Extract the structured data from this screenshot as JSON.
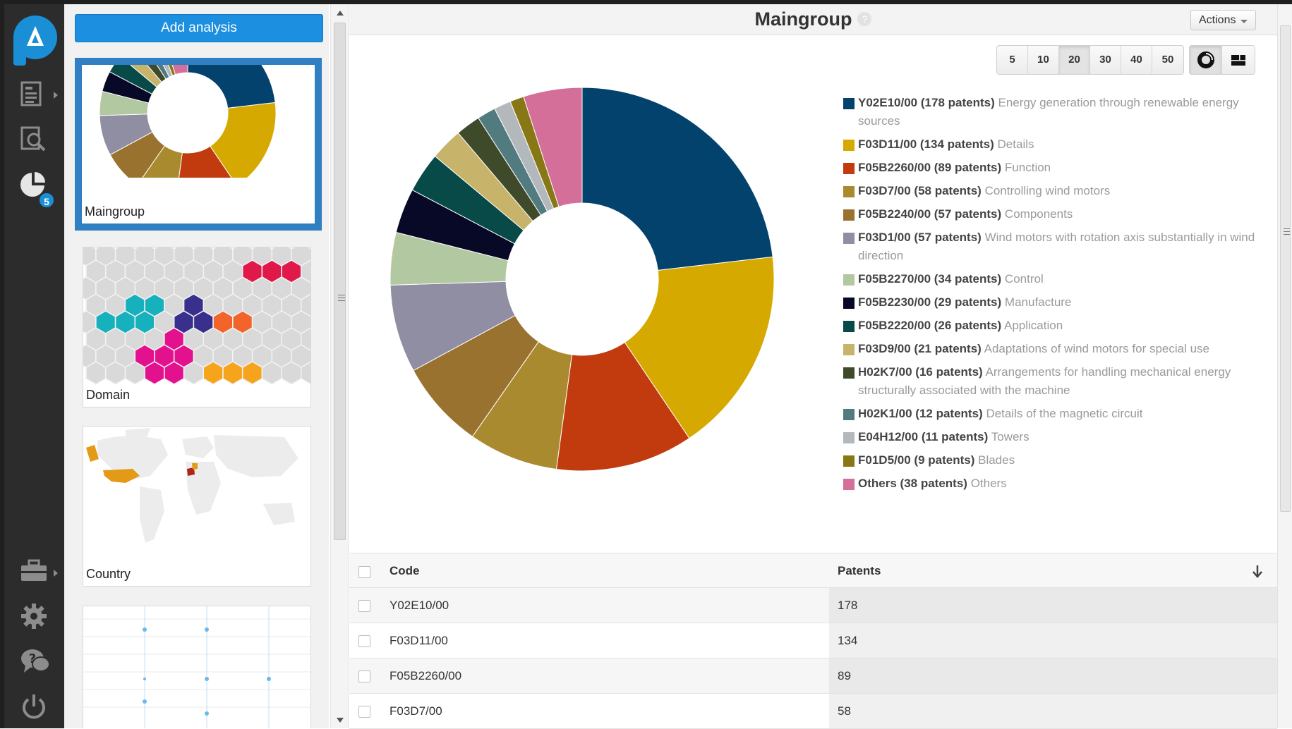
{
  "app": {
    "nav_badge_count": "5"
  },
  "sidebar": {
    "add_button": "Add analysis",
    "thumbnails": [
      {
        "label": "Maingroup",
        "selected": true
      },
      {
        "label": "Domain",
        "selected": false
      },
      {
        "label": "Country",
        "selected": false
      },
      {
        "label": "",
        "selected": false
      }
    ]
  },
  "header": {
    "title": "Maingroup",
    "help": "?",
    "actions_label": "Actions"
  },
  "top_n": {
    "options": [
      "5",
      "10",
      "20",
      "30",
      "40",
      "50"
    ],
    "selected": "20"
  },
  "view_switch": {
    "options": [
      "donut-chart-icon",
      "treemap-icon"
    ],
    "selected": "donut-chart-icon"
  },
  "legend": [
    {
      "code": "Y02E10/00",
      "count": "(178 patents)",
      "desc": "Energy generation through renewable energy sources"
    },
    {
      "code": "F03D11/00",
      "count": "(134 patents)",
      "desc": "Details"
    },
    {
      "code": "F05B2260/00",
      "count": "(89 patents)",
      "desc": "Function"
    },
    {
      "code": "F03D7/00",
      "count": "(58 patents)",
      "desc": "Controlling wind motors"
    },
    {
      "code": "F05B2240/00",
      "count": "(57 patents)",
      "desc": "Components"
    },
    {
      "code": "F03D1/00",
      "count": "(57 patents)",
      "desc": "Wind motors with rotation axis substantially in wind direction"
    },
    {
      "code": "F05B2270/00",
      "count": "(34 patents)",
      "desc": "Control"
    },
    {
      "code": "F05B2230/00",
      "count": "(29 patents)",
      "desc": "Manufacture"
    },
    {
      "code": "F05B2220/00",
      "count": "(26 patents)",
      "desc": "Application"
    },
    {
      "code": "F03D9/00",
      "count": "(21 patents)",
      "desc": "Adaptations of wind motors for special use"
    },
    {
      "code": "H02K7/00",
      "count": "(16 patents)",
      "desc": "Arrangements for handling mechanical energy structurally associated with the machine"
    },
    {
      "code": "H02K1/00",
      "count": "(12 patents)",
      "desc": "Details of the magnetic circuit"
    },
    {
      "code": "E04H12/00",
      "count": "(11 patents)",
      "desc": "Towers"
    },
    {
      "code": "F01D5/00",
      "count": "(9 patents)",
      "desc": "Blades"
    },
    {
      "code": "Others",
      "count": "(38 patents)",
      "desc": "Others"
    }
  ],
  "chart_data": {
    "type": "pie",
    "donut": true,
    "categories": [
      "Y02E10/00",
      "F03D11/00",
      "F05B2260/00",
      "F03D7/00",
      "F05B2240/00",
      "F03D1/00",
      "F05B2270/00",
      "F05B2230/00",
      "F05B2220/00",
      "F03D9/00",
      "H02K7/00",
      "H02K1/00",
      "E04H12/00",
      "F01D5/00",
      "Others"
    ],
    "values": [
      178,
      134,
      89,
      58,
      57,
      57,
      34,
      29,
      26,
      21,
      16,
      12,
      11,
      9,
      38
    ],
    "colors": [
      "#04426e",
      "#d6a900",
      "#c13b0e",
      "#a98a2e",
      "#9a7230",
      "#908ea2",
      "#b2c8a0",
      "#070926",
      "#074a48",
      "#c8b36a",
      "#3f4a2a",
      "#527b80",
      "#b3b8bd",
      "#877715",
      "#d36f98"
    ]
  },
  "table": {
    "headers": {
      "code": "Code",
      "patents": "Patents"
    },
    "rows": [
      {
        "code": "Y02E10/00",
        "patents": "178"
      },
      {
        "code": "F03D11/00",
        "patents": "134"
      },
      {
        "code": "F05B2260/00",
        "patents": "89"
      },
      {
        "code": "F03D7/00",
        "patents": "58"
      }
    ]
  }
}
